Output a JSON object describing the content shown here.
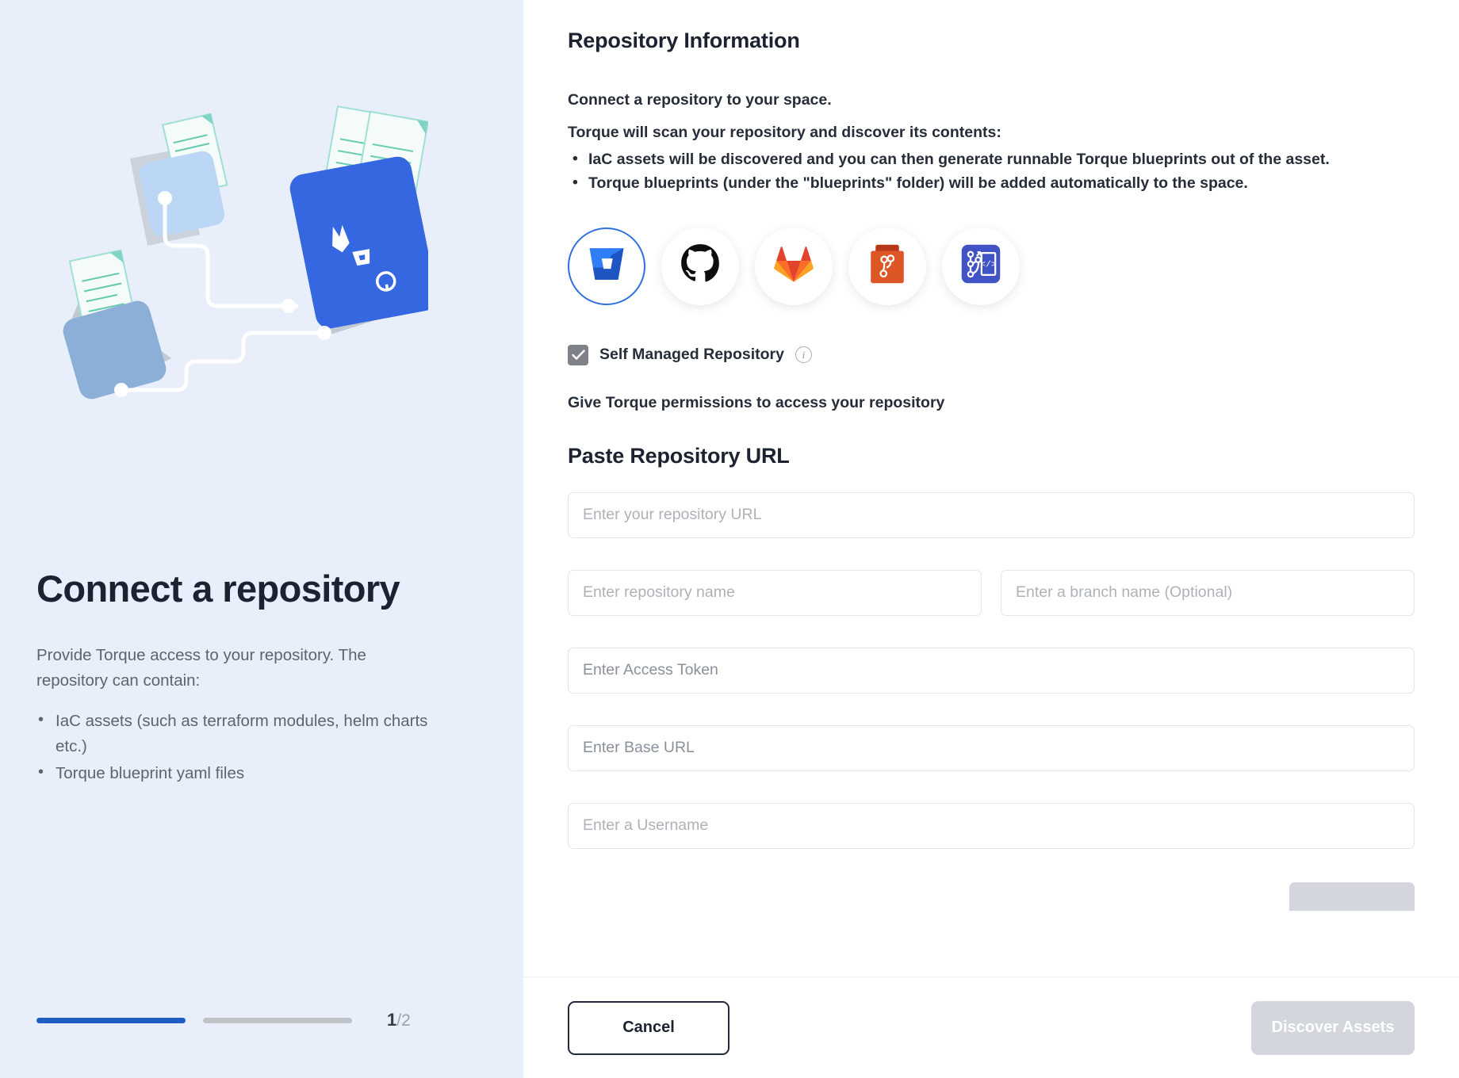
{
  "left": {
    "title": "Connect a repository",
    "subtitle": "Provide Torque access to your repository. The repository can contain:",
    "bullets": [
      "IaC assets (such as terraform modules, helm charts etc.)",
      "Torque blueprint yaml files"
    ],
    "illustration_name": "connect-repository-illustration",
    "progress": {
      "current": "1",
      "total": "/2",
      "steps_done": 1,
      "steps_total": 2,
      "done_color": "#1f5bc4",
      "todo_color": "#bfc3c8"
    }
  },
  "right": {
    "section_title": "Repository Information",
    "lead_bold": "Connect a repository to your space.",
    "lead_sub": "Torque will scan your repository and discover its contents:",
    "info_bullets": [
      "IaC assets will be discovered and you can then generate runnable Torque blueprints out of the asset.",
      "Torque blueprints (under the \"blueprints\" folder) will be added automatically to the space."
    ],
    "providers": [
      {
        "name": "bitbucket",
        "label": "Bitbucket",
        "selected": true
      },
      {
        "name": "github",
        "label": "GitHub",
        "selected": false
      },
      {
        "name": "gitlab",
        "label": "GitLab",
        "selected": false
      },
      {
        "name": "bitbucket-server",
        "label": "Bitbucket Server",
        "selected": false
      },
      {
        "name": "azure-devops",
        "label": "Azure DevOps",
        "selected": false
      }
    ],
    "self_managed": {
      "label": "Self Managed Repository",
      "checked": true,
      "info_glyph": "i"
    },
    "permissions_text": "Give Torque permissions to access your repository",
    "paste_title": "Paste Repository URL",
    "fields": {
      "repo_url_placeholder": "Enter your repository URL",
      "repo_url_value": "",
      "repo_name_placeholder": "Enter repository name",
      "repo_name_value": "",
      "branch_placeholder": "Enter a branch name (Optional)",
      "branch_value": "",
      "access_token_placeholder": "Enter Access Token",
      "access_token_value": "",
      "base_url_placeholder": "Enter Base URL",
      "base_url_value": "",
      "username_placeholder": "Enter a Username",
      "username_value": ""
    },
    "actions": {
      "cancel_label": "Cancel",
      "primary_label": "Discover Assets",
      "primary_disabled": true,
      "primary_disabled_color": "#d3d6dd"
    }
  },
  "theme": {
    "left_bg": "#e8eefa",
    "accent": "#2f6fe0",
    "progress_accent": "#1f5bc4",
    "text_dark": "#1c2230",
    "text_muted": "#5d6470"
  }
}
